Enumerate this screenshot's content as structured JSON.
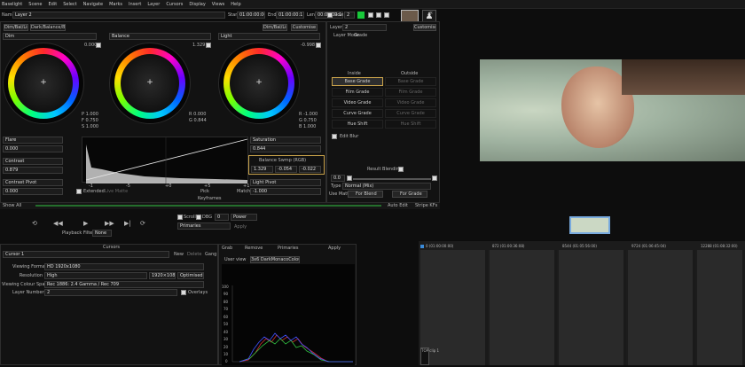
{
  "menu": [
    "Baselight",
    "Scene",
    "Edit",
    "Select",
    "Navigate",
    "Marks",
    "Insert",
    "Layer",
    "Cursors",
    "Display",
    "Views",
    "Help"
  ],
  "header": {
    "name_label": "Name",
    "name_value": "Layer 2",
    "start_label": "Start",
    "start_value": "01:00:00:00",
    "end_label": "End",
    "end_value": "01:00:00:11",
    "len_label": "Len",
    "len_value": "00:00:00:11",
    "row_label": "Row",
    "row_value": "2"
  },
  "tabs": [
    "Dim/Bal/Light",
    "Dark/Balance/Bright"
  ],
  "operator": {
    "name": "Dim/Bal/Light",
    "mode": "Customise"
  },
  "wheels": [
    {
      "label": "Dim",
      "value": "0.000",
      "rows": []
    },
    {
      "label": "Balance",
      "value": "1.329",
      "rows": [
        {
          "k": "R",
          "v": "0.000"
        },
        {
          "k": "G",
          "v": "0.844"
        }
      ]
    },
    {
      "label": "Light",
      "value": "-0.998",
      "rows": [
        {
          "k": "R",
          "v": "-1.000"
        },
        {
          "k": "G",
          "v": "0.750"
        },
        {
          "k": "B",
          "v": "1.000"
        }
      ]
    }
  ],
  "dim_rows": [
    {
      "k": "P",
      "v": "1.000"
    },
    {
      "k": "F",
      "v": "0.750"
    },
    {
      "k": "S",
      "v": "1.000"
    }
  ],
  "left_params": [
    {
      "label": "Flare",
      "value": "0.000"
    },
    {
      "label": "Contrast",
      "value": "0.879"
    },
    {
      "label": "Contrast Pivot",
      "value": "0.000"
    }
  ],
  "right_params": [
    {
      "label": "Saturation",
      "value": "0.844"
    },
    {
      "label": "Balance Swmp (RGB)",
      "values": [
        "1.329",
        "-0.054",
        "-0.022"
      ]
    },
    {
      "label": "Light Pivot",
      "value": "-1.000"
    }
  ],
  "graph": {
    "extended": "Extended",
    "live_matte": "Live Matte",
    "pick": "Pick",
    "match": "Match",
    "ticks": [
      "-1",
      "-5",
      "+0",
      "+5",
      "+1"
    ]
  },
  "layer_panel": {
    "layer_label": "Layer",
    "layer_value": "2",
    "mode_label": "Layer Mode",
    "mode_value": "Grade",
    "customise": "Customise",
    "inside": "Inside",
    "outside": "Outside",
    "grades": [
      {
        "in": "Base Grade",
        "out": "Base Grade"
      },
      {
        "in": "Film Grade",
        "out": "Film Grade"
      },
      {
        "in": "Video Grade",
        "out": "Video Grade"
      },
      {
        "in": "Curve Grade",
        "out": "Curve Grade"
      },
      {
        "in": "Hue Shift",
        "out": "Hue Shift"
      }
    ],
    "edit_blur": "Edit Blur",
    "result_blending": "Result Blending",
    "blend_value": "0.0",
    "type_label": "Type",
    "type_value": "Normal (Mix)",
    "use_matte": "Use Matte",
    "for_blend": "For Blend",
    "for_grade": "For Grade"
  },
  "bottom_bar": {
    "show_all": "Show All",
    "auto_edit": "Auto Edit",
    "stripe": "Stripe KFs",
    "keyframes": "Keyframes"
  },
  "transport": {
    "playback_label": "Playback Filtering",
    "playback_value": "None",
    "scroll": "Scroll",
    "dbg": "DBG",
    "dbg_value": "0",
    "power": "Power",
    "primaries": "Primaries",
    "apply": "Apply"
  },
  "cursors": {
    "title": "Cursors",
    "cursor_value": "Cursor 1",
    "new": "New",
    "delete": "Delete",
    "gang": "Gang",
    "fields": [
      {
        "label": "Viewing Format",
        "value": "HD 1920x1080"
      },
      {
        "label": "Resolution",
        "value": "High",
        "extra": "1920×1080",
        "extra2": "Optimised"
      },
      {
        "label": "Viewing Colour Space",
        "value": "Rec 1886: 2.4 Gamma / Rec 709"
      },
      {
        "label": "Layer Number",
        "value": "2",
        "extra": "Overlays"
      }
    ]
  },
  "scope": {
    "grab": "Grab",
    "remove": "Remove",
    "primaries": "Primaries",
    "apply": "Apply",
    "user_view": "User view",
    "tab": "3x6 DarkMonacoColour",
    "y_ticks": [
      "100",
      "90",
      "80",
      "70",
      "60",
      "50",
      "40",
      "30",
      "20",
      "10",
      "0"
    ]
  },
  "timeline": {
    "clips": [
      {
        "tc": "0 (01:00:00:00)"
      },
      {
        "tc": "872 (01:00:36:08)"
      },
      {
        "tc": "8544 (01:05:56:00)"
      },
      {
        "tc": "9724 (01:06:45:04)"
      },
      {
        "tc": "12288 (01:08:32:00)"
      }
    ],
    "bottom_label": "TOP clip 1"
  }
}
